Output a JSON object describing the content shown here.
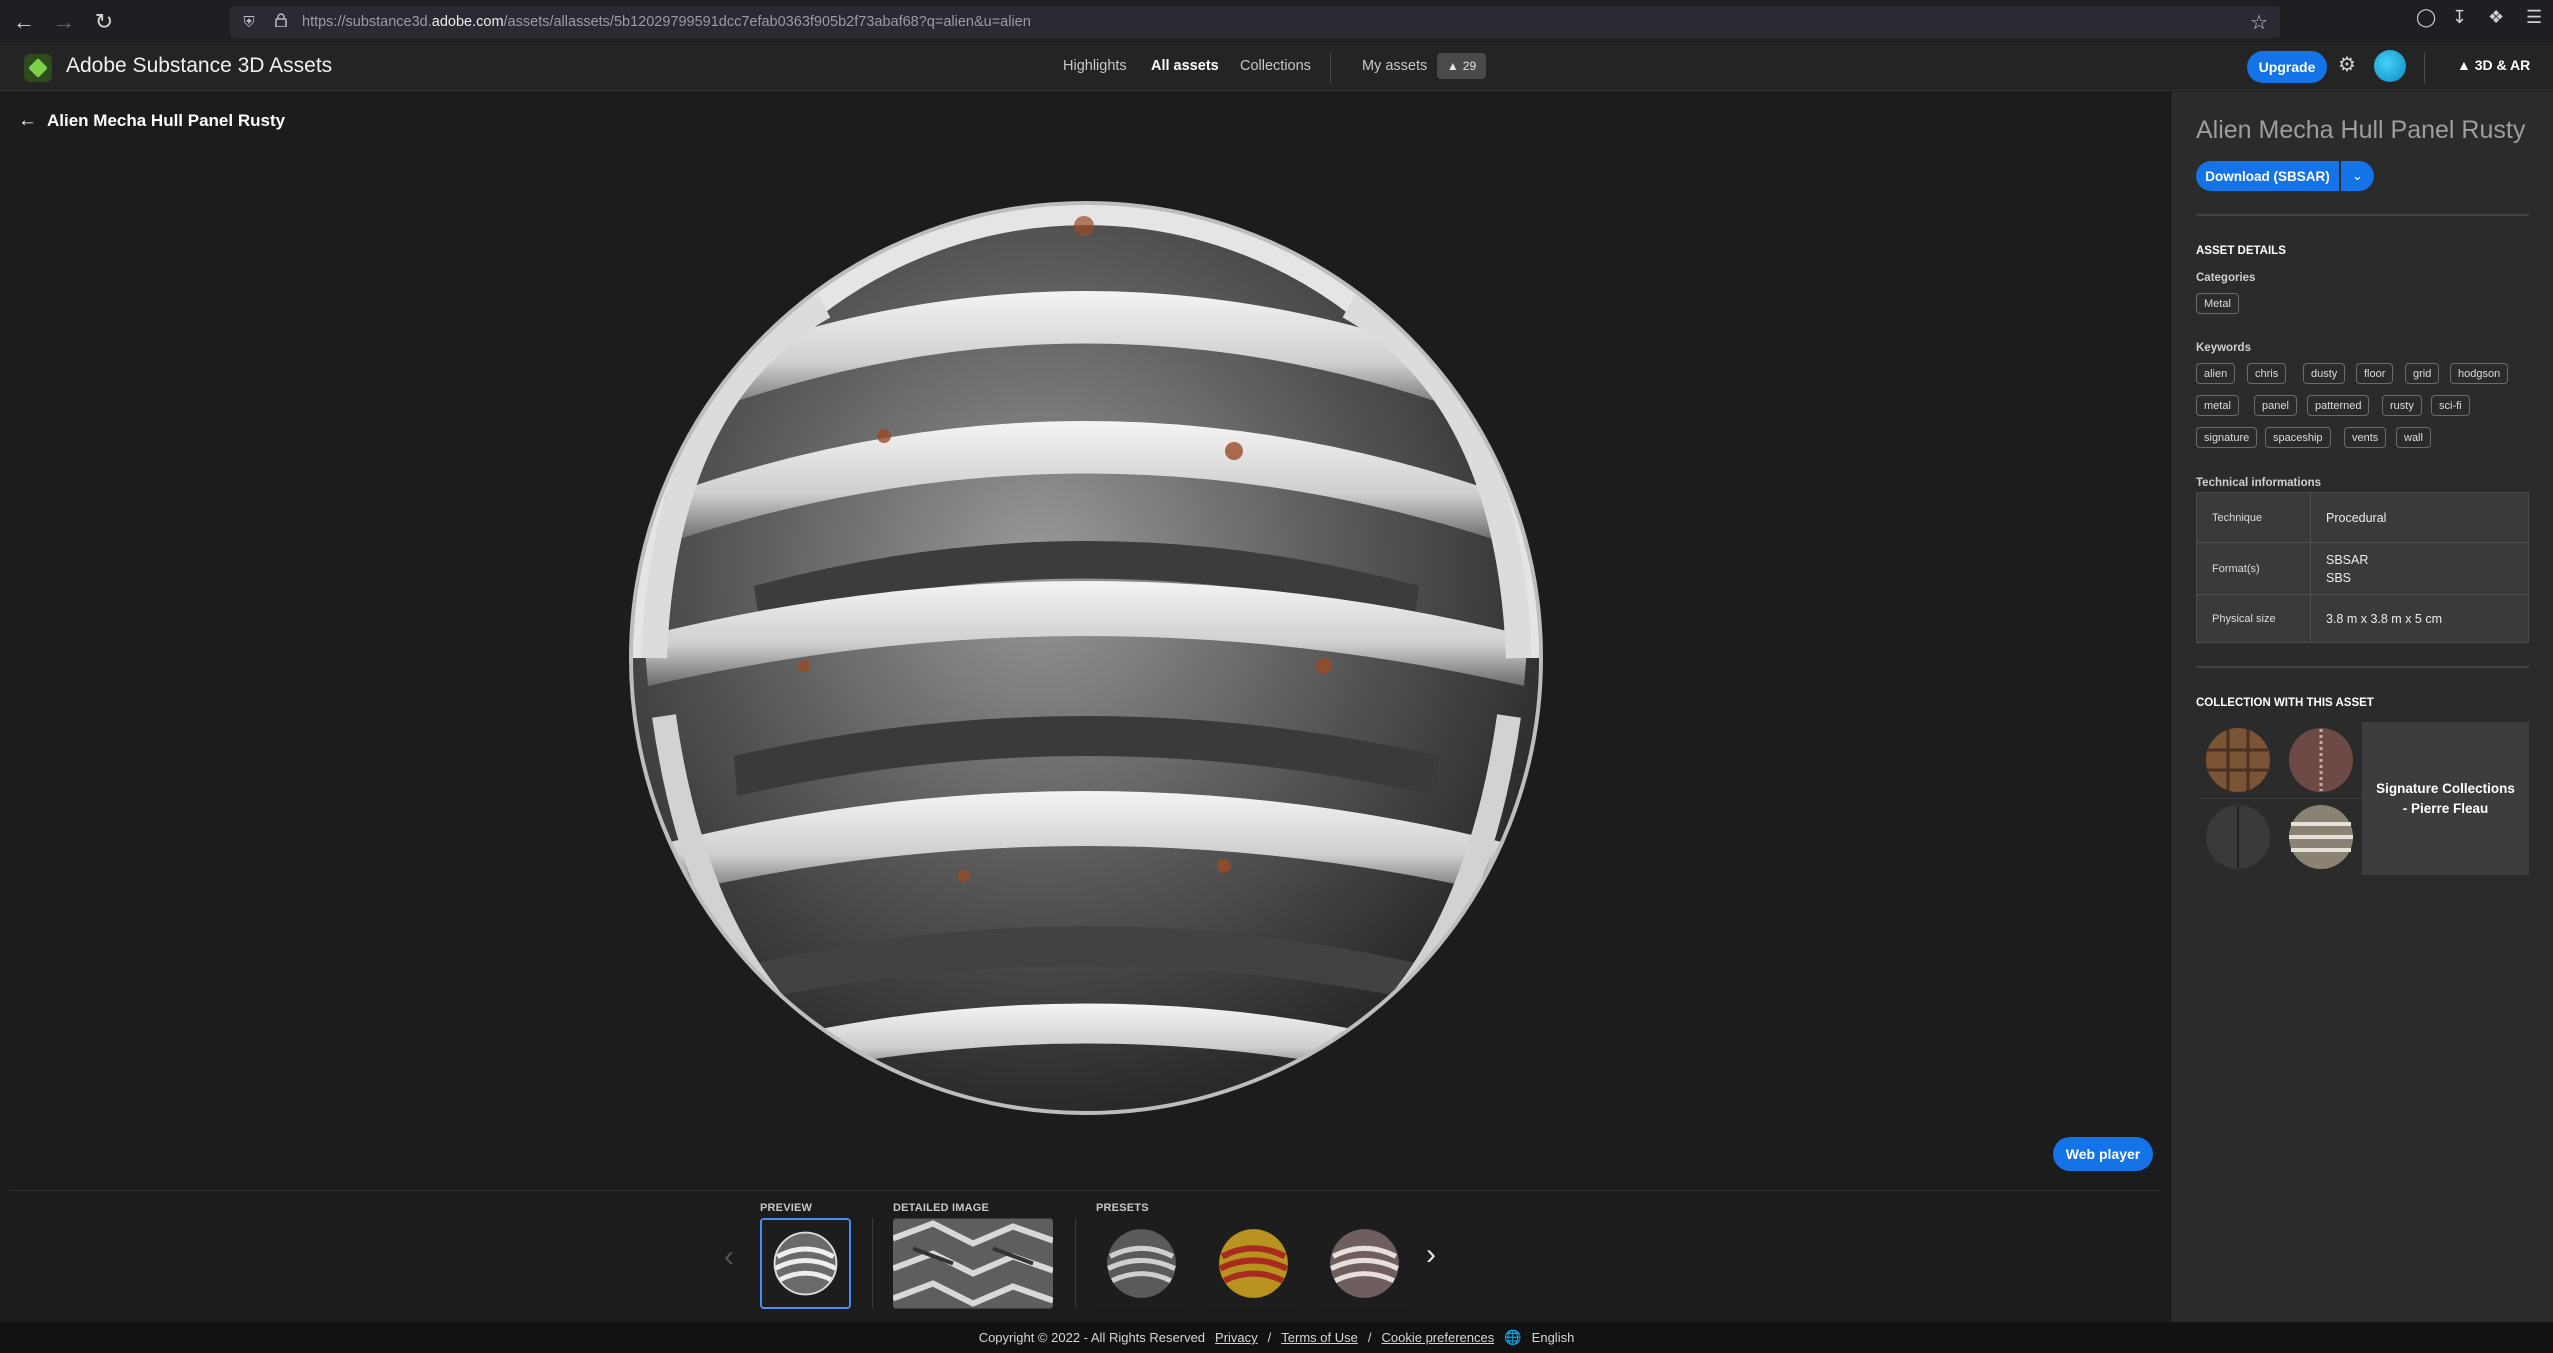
{
  "browser": {
    "url_prefix": "https://substance3d.",
    "url_domain": "adobe.com",
    "url_suffix": "/assets/allassets/5b12029799591dcc7efab0363f905b2f73abaf68?q=alien&u=alien"
  },
  "header": {
    "app_title": "Adobe Substance 3D Assets",
    "nav": [
      "Highlights",
      "All assets",
      "Collections",
      "My assets"
    ],
    "active_nav": "All assets",
    "credits": "29",
    "upgrade_label": "Upgrade",
    "ar_label": "3D & AR"
  },
  "page": {
    "title": "Alien Mecha Hull Panel Rusty",
    "web_player_label": "Web player"
  },
  "strip": {
    "preview_label": "PREVIEW",
    "detailed_label": "DETAILED IMAGE",
    "presets_label": "PRESETS"
  },
  "panel": {
    "asset_title": "Alien Mecha Hull Panel Rusty",
    "download_label": "Download (SBSAR)",
    "details_heading": "ASSET DETAILS",
    "categories_heading": "Categories",
    "categories": [
      "Metal"
    ],
    "keywords_heading": "Keywords",
    "keywords": [
      "alien",
      "chris",
      "dusty",
      "floor",
      "grid",
      "hodgson",
      "metal",
      "panel",
      "patterned",
      "rusty",
      "sci-fi",
      "signature",
      "spaceship",
      "vents",
      "wall"
    ],
    "tech_heading": "Technical informations",
    "tech": {
      "technique_label": "Technique",
      "technique_value": "Procedural",
      "formats_label": "Format(s)",
      "format_1": "SBSAR",
      "format_2": "SBS",
      "size_label": "Physical size",
      "size_value": "3.8 m x 3.8 m x 5 cm"
    },
    "collection_heading": "COLLECTION WITH THIS ASSET",
    "collection_name": "Signature Collections - Pierre Fleau"
  },
  "footer": {
    "copyright": "Copyright © 2022 - All Rights Reserved",
    "privacy": "Privacy",
    "terms": "Terms of Use",
    "cookies": "Cookie preferences",
    "language": "English"
  },
  "colors": {
    "accent": "#1473e6",
    "background": "#1c1c1c",
    "panel": "#2b2b2b"
  }
}
